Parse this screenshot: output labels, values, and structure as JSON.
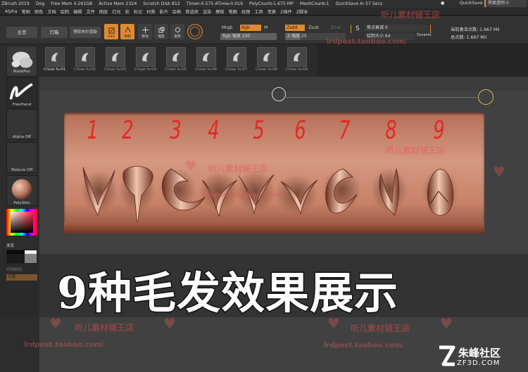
{
  "titlebar": {
    "app": "ZBrush 2019",
    "user": "Dog",
    "free_mem": "Free Mem 4.261GB",
    "active_mem": "Active Mem 2324",
    "scratch": "Scratch Disk 812",
    "timer": "Timer▹0.575 ATime▹0.019",
    "poly": "PolyCount▹1.675 MP",
    "mesh": "MeshCount▹1",
    "quicksave": "QuickSave In 57 Secs",
    "qs": "QuickSave",
    "transparency": "界面透明 0"
  },
  "menu": [
    "Alpha",
    "笔刷",
    "颜色",
    "文档",
    "绘制",
    "编辑",
    "文件",
    "图层",
    "灯光",
    "宏",
    "标记",
    "材质",
    "影片",
    "绘框",
    "首选项",
    "渲染",
    "模板",
    "笔触",
    "纹理",
    "工具",
    "变换",
    "Z插件",
    "Z脚本"
  ],
  "shelf": {
    "home": "主页",
    "lightbox": "灯箱",
    "preview": "预览布尔渲染",
    "edit": "Edit",
    "draw": "绘制",
    "move": "移动",
    "scale": "缩放",
    "rotate": "旋转",
    "mrgb": "Mrgb",
    "rgb": "Rgb",
    "m": "M",
    "rgb_intensity": "Rgb 强度 100",
    "zadd": "Zadd",
    "zsub": "Zsub",
    "zcut": "Zcut",
    "z_intensity": "Z 强度 25",
    "s_label": "S",
    "focal_shift": "焦点衰减 0",
    "draw_size": "绘制大小 64",
    "dynamic": "Dynamic",
    "active_points": "当前激活点数: 1.667 Mil",
    "total_points": "总点数: 1.667 Mil"
  },
  "left": {
    "maskpen": "MaskPen",
    "freehand": "FreeHand",
    "alpha_off": "Alpha Off",
    "texture_off": "Texture Off",
    "polyskin": "PolySkin",
    "gradient": "渐变",
    "switch_color": "切换颜色",
    "alternate": "交替"
  },
  "brushes": [
    "Chisel fur01",
    "Chisel fur02",
    "Chisel fur03",
    "Chisel fur04",
    "Chisel fur05",
    "Chisel fur06",
    "Chisel fur07",
    "Chisel fur08",
    "Chisel fur09"
  ],
  "numbers": [
    "1",
    "2",
    "3",
    "4",
    "5",
    "6",
    "7",
    "8",
    "9"
  ],
  "banner": "9种毛发效果展示",
  "watermarks": {
    "shop": "听儿素材铺王店",
    "url": "lrdpost.taobao.com/"
  },
  "logo": {
    "name": "朱峰社区",
    "url": "ZF3D.COM"
  },
  "colors": {
    "accent": "#e08a30",
    "number_red": "#e02a2a"
  }
}
